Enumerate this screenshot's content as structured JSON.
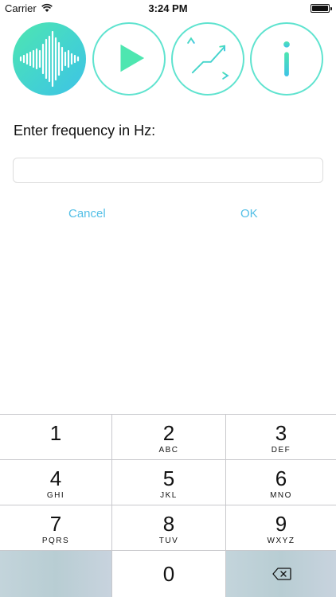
{
  "status_bar": {
    "carrier": "Carrier",
    "time": "3:24 PM"
  },
  "toolbar": {
    "buttons": [
      {
        "icon": "waveform-icon",
        "active": true
      },
      {
        "icon": "play-icon",
        "active": false
      },
      {
        "icon": "graph-icon",
        "active": false
      },
      {
        "icon": "info-icon",
        "active": false
      }
    ],
    "colors": {
      "accent_start": "#4ee6b0",
      "accent_end": "#3ec3e6",
      "outline": "#5fe3cf"
    }
  },
  "form": {
    "prompt": "Enter frequency in Hz:",
    "input_value": "",
    "input_placeholder": "",
    "cancel_label": "Cancel",
    "ok_label": "OK",
    "action_color": "#53bfe6"
  },
  "keypad": {
    "keys": [
      {
        "num": "1",
        "letters": ""
      },
      {
        "num": "2",
        "letters": "ABC"
      },
      {
        "num": "3",
        "letters": "DEF"
      },
      {
        "num": "4",
        "letters": "GHI"
      },
      {
        "num": "5",
        "letters": "JKL"
      },
      {
        "num": "6",
        "letters": "MNO"
      },
      {
        "num": "7",
        "letters": "PQRS"
      },
      {
        "num": "8",
        "letters": "TUV"
      },
      {
        "num": "9",
        "letters": "WXYZ"
      },
      {
        "num": "0",
        "letters": ""
      }
    ]
  }
}
